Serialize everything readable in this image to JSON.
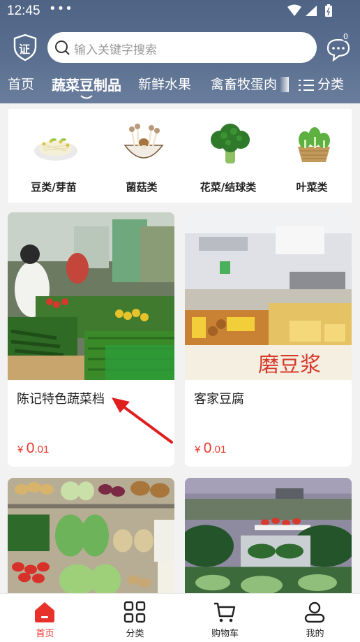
{
  "status_bar": {
    "time": "12:45",
    "dots": "•••"
  },
  "header": {
    "shield_label": "证",
    "search": {
      "placeholder": "输入关键字搜索"
    },
    "message_count": "0"
  },
  "tabs": {
    "items": [
      {
        "label": "首页"
      },
      {
        "label": "蔬菜豆制品"
      },
      {
        "label": "新鲜水果"
      },
      {
        "label": "禽畜牧蛋肉"
      }
    ],
    "active_index": 1,
    "more_label": "分类"
  },
  "categories": [
    {
      "label": "豆类/芽苗",
      "icon": "bean-sprouts-icon"
    },
    {
      "label": "菌菇类",
      "icon": "mushroom-icon"
    },
    {
      "label": "花菜/结球类",
      "icon": "broccoli-icon"
    },
    {
      "label": "叶菜类",
      "icon": "leafy-greens-icon"
    }
  ],
  "products": [
    {
      "name": "陈记特色蔬菜档",
      "price_symbol": "¥",
      "price_int": "0",
      "price_dec": ".01"
    },
    {
      "name": "客家豆腐",
      "price_symbol": "¥",
      "price_int": "0",
      "price_dec": ".01",
      "sign_text": "磨豆浆"
    },
    {
      "name": "",
      "price_symbol": "",
      "price_int": "",
      "price_dec": ""
    },
    {
      "name": "",
      "price_symbol": "",
      "price_int": "",
      "price_dec": ""
    }
  ],
  "bottom_nav": [
    {
      "label": "首页",
      "icon": "home-icon"
    },
    {
      "label": "分类",
      "icon": "grid-icon"
    },
    {
      "label": "购物车",
      "icon": "cart-icon"
    },
    {
      "label": "我的",
      "icon": "user-icon"
    }
  ],
  "colors": {
    "header": "#56698b",
    "price": "#e83a2e",
    "nav_active": "#e8312a",
    "arrow": "#e01e1e"
  }
}
